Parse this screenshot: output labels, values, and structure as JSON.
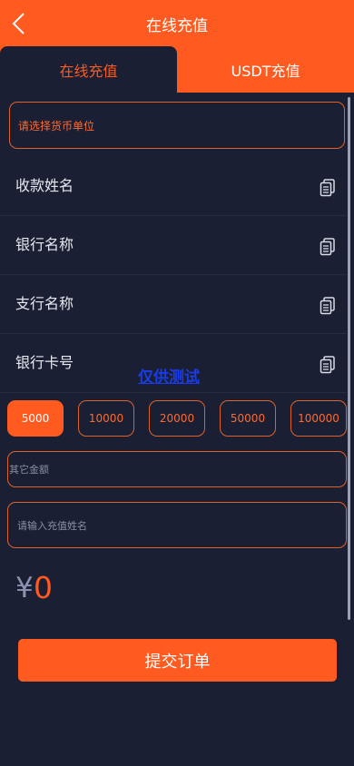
{
  "header": {
    "title": "在线充值",
    "tabs": [
      "在线充值",
      "USDT充值"
    ]
  },
  "currency_select": {
    "placeholder": "请选择货币单位"
  },
  "info_rows": [
    {
      "label": "收款姓名"
    },
    {
      "label": "银行名称"
    },
    {
      "label": "支行名称"
    },
    {
      "label": "银行卡号"
    }
  ],
  "watermark": "仅供测试",
  "amounts": [
    "5000",
    "10000",
    "20000",
    "50000",
    "100000"
  ],
  "selected_amount": "5000",
  "other_amount": {
    "placeholder": "其它金额"
  },
  "name_input": {
    "placeholder": "请输入充值姓名"
  },
  "total": {
    "currency": "¥",
    "value": "0"
  },
  "submit_label": "提交订单",
  "colors": {
    "accent": "#ff5a1f",
    "background": "#1a1f33"
  }
}
